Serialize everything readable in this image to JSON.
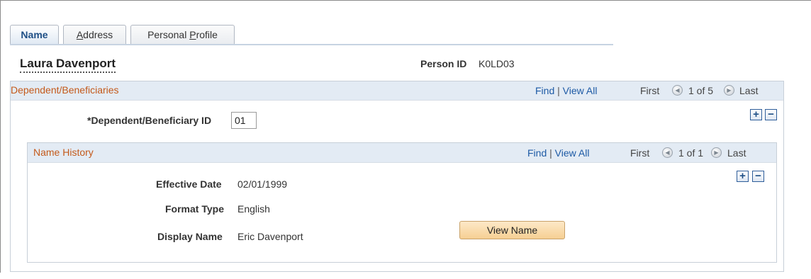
{
  "tabs": [
    {
      "label": "Name",
      "active": true
    },
    {
      "label_pre": "",
      "label_ul": "A",
      "label_post": "ddress"
    },
    {
      "label_pre": "Personal ",
      "label_ul": "P",
      "label_post": "rofile"
    }
  ],
  "employee": {
    "name": "Laura Davenport",
    "person_id_label": "Person ID",
    "person_id_value": "K0LD03"
  },
  "dependents": {
    "title": "Dependent/Beneficiaries",
    "find": "Find",
    "separator": "|",
    "view_all": "View All",
    "first": "First",
    "position": "1 of 5",
    "last": "Last",
    "field_label": "*Dependent/Beneficiary ID",
    "field_value": "01"
  },
  "name_history": {
    "title": "Name History",
    "find": "Find",
    "separator": "|",
    "view_all": "View All",
    "first": "First",
    "position": "1 of 1",
    "last": "Last",
    "effective_date_label": "Effective Date",
    "effective_date_value": "02/01/1999",
    "format_type_label": "Format Type",
    "format_type_value": "English",
    "display_name_label": "Display Name",
    "display_name_value": "Eric Davenport",
    "view_name_button": "View Name"
  },
  "buttons": {
    "add": "+",
    "remove": "−"
  },
  "icons": {
    "prev": "prev-arrow-icon",
    "next": "next-arrow-icon"
  },
  "colors": {
    "section_title": "#c45a1b",
    "link": "#1d5aa5",
    "header_bg": "#e3ebf4",
    "button_bg": "#f6cf93"
  }
}
